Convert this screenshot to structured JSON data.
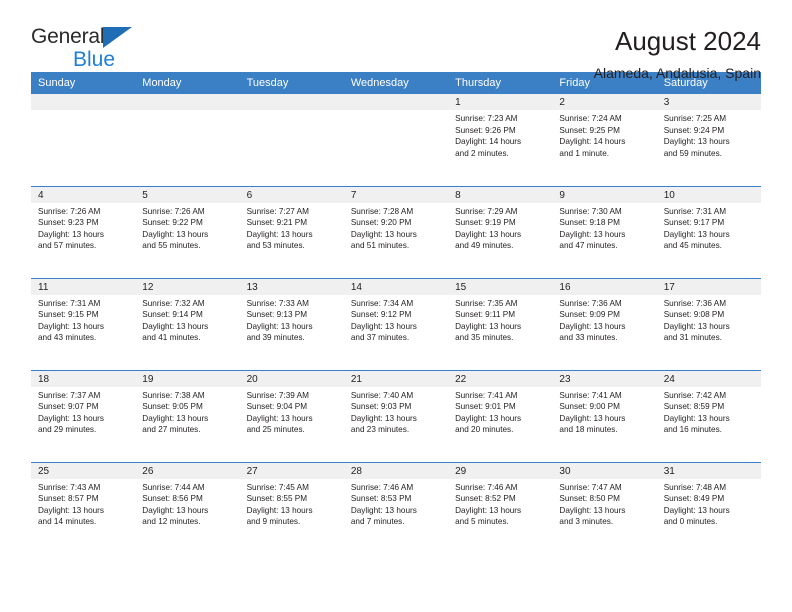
{
  "brand": {
    "name_part1": "General",
    "name_part2": "Blue",
    "logo_icon": "triangle-logo-mark"
  },
  "header": {
    "title": "August 2024",
    "location": "Alameda, Andalusia, Spain"
  },
  "calendar": {
    "weekdays": [
      "Sunday",
      "Monday",
      "Tuesday",
      "Wednesday",
      "Thursday",
      "Friday",
      "Saturday"
    ],
    "colors": {
      "header_blue": "#3b7fc4",
      "daynum_band": "#f0f0f0",
      "brand_blue": "#1f7fd4",
      "text": "#231f20"
    },
    "weeks": [
      [
        {
          "day": ""
        },
        {
          "day": ""
        },
        {
          "day": ""
        },
        {
          "day": ""
        },
        {
          "day": "1",
          "sunrise": "Sunrise: 7:23 AM",
          "sunset": "Sunset: 9:26 PM",
          "daylight1": "Daylight: 14 hours",
          "daylight2": "and 2 minutes."
        },
        {
          "day": "2",
          "sunrise": "Sunrise: 7:24 AM",
          "sunset": "Sunset: 9:25 PM",
          "daylight1": "Daylight: 14 hours",
          "daylight2": "and 1 minute."
        },
        {
          "day": "3",
          "sunrise": "Sunrise: 7:25 AM",
          "sunset": "Sunset: 9:24 PM",
          "daylight1": "Daylight: 13 hours",
          "daylight2": "and 59 minutes."
        }
      ],
      [
        {
          "day": "4",
          "sunrise": "Sunrise: 7:26 AM",
          "sunset": "Sunset: 9:23 PM",
          "daylight1": "Daylight: 13 hours",
          "daylight2": "and 57 minutes."
        },
        {
          "day": "5",
          "sunrise": "Sunrise: 7:26 AM",
          "sunset": "Sunset: 9:22 PM",
          "daylight1": "Daylight: 13 hours",
          "daylight2": "and 55 minutes."
        },
        {
          "day": "6",
          "sunrise": "Sunrise: 7:27 AM",
          "sunset": "Sunset: 9:21 PM",
          "daylight1": "Daylight: 13 hours",
          "daylight2": "and 53 minutes."
        },
        {
          "day": "7",
          "sunrise": "Sunrise: 7:28 AM",
          "sunset": "Sunset: 9:20 PM",
          "daylight1": "Daylight: 13 hours",
          "daylight2": "and 51 minutes."
        },
        {
          "day": "8",
          "sunrise": "Sunrise: 7:29 AM",
          "sunset": "Sunset: 9:19 PM",
          "daylight1": "Daylight: 13 hours",
          "daylight2": "and 49 minutes."
        },
        {
          "day": "9",
          "sunrise": "Sunrise: 7:30 AM",
          "sunset": "Sunset: 9:18 PM",
          "daylight1": "Daylight: 13 hours",
          "daylight2": "and 47 minutes."
        },
        {
          "day": "10",
          "sunrise": "Sunrise: 7:31 AM",
          "sunset": "Sunset: 9:17 PM",
          "daylight1": "Daylight: 13 hours",
          "daylight2": "and 45 minutes."
        }
      ],
      [
        {
          "day": "11",
          "sunrise": "Sunrise: 7:31 AM",
          "sunset": "Sunset: 9:15 PM",
          "daylight1": "Daylight: 13 hours",
          "daylight2": "and 43 minutes."
        },
        {
          "day": "12",
          "sunrise": "Sunrise: 7:32 AM",
          "sunset": "Sunset: 9:14 PM",
          "daylight1": "Daylight: 13 hours",
          "daylight2": "and 41 minutes."
        },
        {
          "day": "13",
          "sunrise": "Sunrise: 7:33 AM",
          "sunset": "Sunset: 9:13 PM",
          "daylight1": "Daylight: 13 hours",
          "daylight2": "and 39 minutes."
        },
        {
          "day": "14",
          "sunrise": "Sunrise: 7:34 AM",
          "sunset": "Sunset: 9:12 PM",
          "daylight1": "Daylight: 13 hours",
          "daylight2": "and 37 minutes."
        },
        {
          "day": "15",
          "sunrise": "Sunrise: 7:35 AM",
          "sunset": "Sunset: 9:11 PM",
          "daylight1": "Daylight: 13 hours",
          "daylight2": "and 35 minutes."
        },
        {
          "day": "16",
          "sunrise": "Sunrise: 7:36 AM",
          "sunset": "Sunset: 9:09 PM",
          "daylight1": "Daylight: 13 hours",
          "daylight2": "and 33 minutes."
        },
        {
          "day": "17",
          "sunrise": "Sunrise: 7:36 AM",
          "sunset": "Sunset: 9:08 PM",
          "daylight1": "Daylight: 13 hours",
          "daylight2": "and 31 minutes."
        }
      ],
      [
        {
          "day": "18",
          "sunrise": "Sunrise: 7:37 AM",
          "sunset": "Sunset: 9:07 PM",
          "daylight1": "Daylight: 13 hours",
          "daylight2": "and 29 minutes."
        },
        {
          "day": "19",
          "sunrise": "Sunrise: 7:38 AM",
          "sunset": "Sunset: 9:05 PM",
          "daylight1": "Daylight: 13 hours",
          "daylight2": "and 27 minutes."
        },
        {
          "day": "20",
          "sunrise": "Sunrise: 7:39 AM",
          "sunset": "Sunset: 9:04 PM",
          "daylight1": "Daylight: 13 hours",
          "daylight2": "and 25 minutes."
        },
        {
          "day": "21",
          "sunrise": "Sunrise: 7:40 AM",
          "sunset": "Sunset: 9:03 PM",
          "daylight1": "Daylight: 13 hours",
          "daylight2": "and 23 minutes."
        },
        {
          "day": "22",
          "sunrise": "Sunrise: 7:41 AM",
          "sunset": "Sunset: 9:01 PM",
          "daylight1": "Daylight: 13 hours",
          "daylight2": "and 20 minutes."
        },
        {
          "day": "23",
          "sunrise": "Sunrise: 7:41 AM",
          "sunset": "Sunset: 9:00 PM",
          "daylight1": "Daylight: 13 hours",
          "daylight2": "and 18 minutes."
        },
        {
          "day": "24",
          "sunrise": "Sunrise: 7:42 AM",
          "sunset": "Sunset: 8:59 PM",
          "daylight1": "Daylight: 13 hours",
          "daylight2": "and 16 minutes."
        }
      ],
      [
        {
          "day": "25",
          "sunrise": "Sunrise: 7:43 AM",
          "sunset": "Sunset: 8:57 PM",
          "daylight1": "Daylight: 13 hours",
          "daylight2": "and 14 minutes."
        },
        {
          "day": "26",
          "sunrise": "Sunrise: 7:44 AM",
          "sunset": "Sunset: 8:56 PM",
          "daylight1": "Daylight: 13 hours",
          "daylight2": "and 12 minutes."
        },
        {
          "day": "27",
          "sunrise": "Sunrise: 7:45 AM",
          "sunset": "Sunset: 8:55 PM",
          "daylight1": "Daylight: 13 hours",
          "daylight2": "and 9 minutes."
        },
        {
          "day": "28",
          "sunrise": "Sunrise: 7:46 AM",
          "sunset": "Sunset: 8:53 PM",
          "daylight1": "Daylight: 13 hours",
          "daylight2": "and 7 minutes."
        },
        {
          "day": "29",
          "sunrise": "Sunrise: 7:46 AM",
          "sunset": "Sunset: 8:52 PM",
          "daylight1": "Daylight: 13 hours",
          "daylight2": "and 5 minutes."
        },
        {
          "day": "30",
          "sunrise": "Sunrise: 7:47 AM",
          "sunset": "Sunset: 8:50 PM",
          "daylight1": "Daylight: 13 hours",
          "daylight2": "and 3 minutes."
        },
        {
          "day": "31",
          "sunrise": "Sunrise: 7:48 AM",
          "sunset": "Sunset: 8:49 PM",
          "daylight1": "Daylight: 13 hours",
          "daylight2": "and 0 minutes."
        }
      ]
    ]
  }
}
